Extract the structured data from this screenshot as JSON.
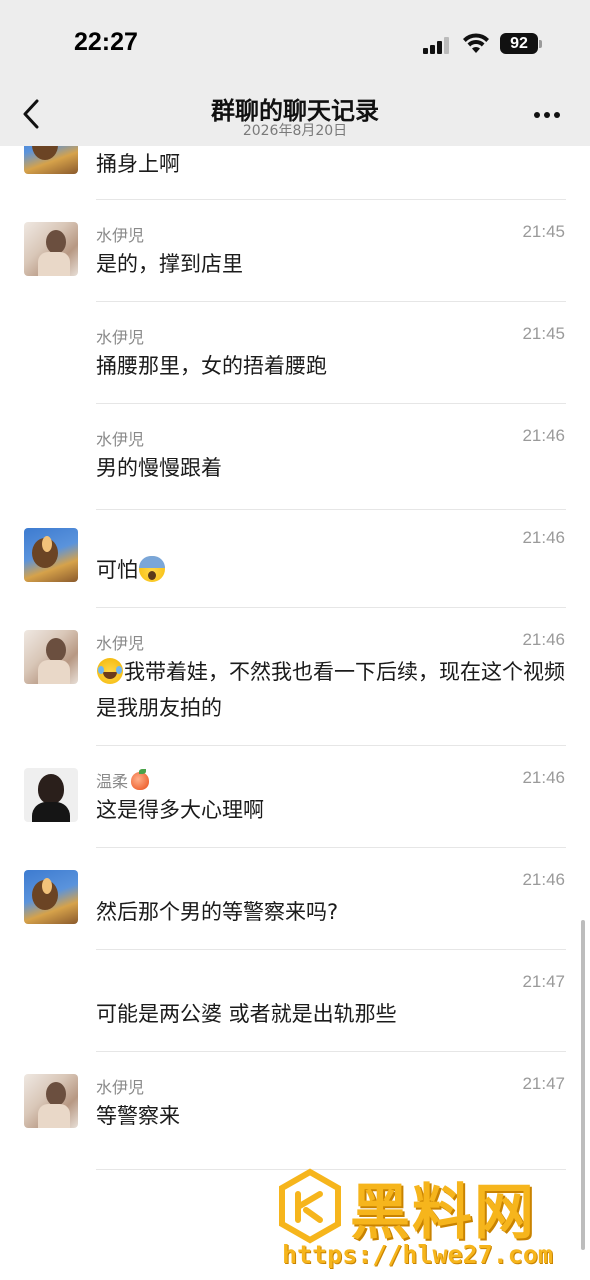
{
  "status_bar": {
    "time": "22:27",
    "battery": "92"
  },
  "nav": {
    "title": "群聊的聊天记录",
    "subtitle": "2026年8月20日"
  },
  "messages": [
    {
      "sender": "",
      "time": "",
      "text": "捅身上啊",
      "avatar": "sun"
    },
    {
      "sender": "水伊児",
      "time": "21:45",
      "text": "是的，撑到店里",
      "avatar": "water"
    },
    {
      "sender": "水伊児",
      "time": "21:45",
      "text": "捅腰那里，女的捂着腰跑",
      "avatar": ""
    },
    {
      "sender": "水伊児",
      "time": "21:46",
      "text": "男的慢慢跟着",
      "avatar": ""
    },
    {
      "sender": "",
      "time": "21:46",
      "text": "可怕",
      "avatar": "sun"
    },
    {
      "sender": "水伊児",
      "time": "21:46",
      "text": "我带着娃，不然我也看一下后续，现在这个视频是我朋友拍的",
      "avatar": "water"
    },
    {
      "sender": "温柔",
      "time": "21:46",
      "text": "这是得多大心理啊",
      "avatar": "wen"
    },
    {
      "sender": "",
      "time": "21:46",
      "text": "然后那个男的等警察来吗?",
      "avatar": "sun"
    },
    {
      "sender": "",
      "time": "21:47",
      "text": "可能是两公婆 或者就是出轨那些",
      "avatar": ""
    },
    {
      "sender": "水伊児",
      "time": "21:47",
      "text": "等警察来",
      "avatar": "water"
    }
  ],
  "watermark": {
    "name": "黑料网",
    "url": "https://hlwe27.com"
  },
  "colors": {
    "accent": "#f6b51c",
    "header_bg": "#ededed",
    "meta_text": "#9a9a9a"
  },
  "icons": [
    "back-icon",
    "more-icon",
    "signal-icon",
    "wifi-icon",
    "battery-icon"
  ]
}
